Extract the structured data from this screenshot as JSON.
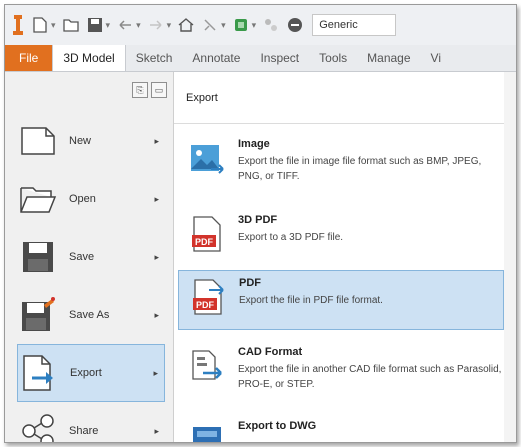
{
  "toolbar": {
    "workspace_value": "Generic"
  },
  "tabs": [
    {
      "label": "File"
    },
    {
      "label": "3D Model"
    },
    {
      "label": "Sketch"
    },
    {
      "label": "Annotate"
    },
    {
      "label": "Inspect"
    },
    {
      "label": "Tools"
    },
    {
      "label": "Manage"
    },
    {
      "label": "Vi"
    }
  ],
  "menu": {
    "items": [
      {
        "label": "New"
      },
      {
        "label": "Open"
      },
      {
        "label": "Save"
      },
      {
        "label": "Save As"
      },
      {
        "label": "Export"
      },
      {
        "label": "Share"
      }
    ]
  },
  "export": {
    "title": "Export",
    "items": [
      {
        "title": "Image",
        "desc": "Export the file in image file format such as BMP, JPEG, PNG, or TIFF."
      },
      {
        "title": "3D PDF",
        "desc": "Export to a 3D PDF file."
      },
      {
        "title": "PDF",
        "desc": "Export the file in PDF file format."
      },
      {
        "title": "CAD Format",
        "desc": "Export the file in another CAD file format such as Parasolid, PRO-E, or STEP."
      },
      {
        "title": "Export to DWG",
        "desc": ""
      }
    ]
  },
  "colors": {
    "file_tab": "#e1701f",
    "selection": "#cde1f3",
    "pdf_red": "#d2332b"
  }
}
